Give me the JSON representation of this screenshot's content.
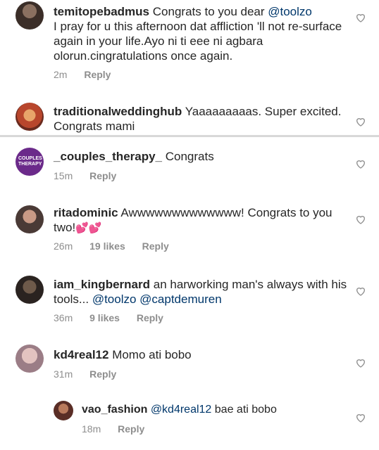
{
  "comments": [
    {
      "username": "temitopebadmus",
      "text_a": "Congrats to you dear ",
      "mention_a": "@toolzo",
      "text_b": "I pray for u this afternoon dat affliction 'll not re-surface again in your life.Ayo ni ti eee ni agbara olorun.cingratulations once again.",
      "time": "2m",
      "reply": "Reply"
    },
    {
      "username": "traditionalweddinghub",
      "text_a": "Yaaaaaaaaas.  Super excited. Congrats mami"
    },
    {
      "username": "_couples_therapy_",
      "text_a": "Congrats",
      "time": "15m",
      "reply": "Reply",
      "avatar_text": "COUPLES THERAPY"
    },
    {
      "username": "ritadominic",
      "text_a": "Awwwwwwwwwwwww! Congrats to you two!",
      "emoji": "💕💕",
      "time": "26m",
      "likes": "19 likes",
      "reply": "Reply"
    },
    {
      "username": "iam_kingbernard",
      "text_a": "an harworking man's always with his tools... ",
      "mention_a": "@toolzo",
      "mention_b": "@captdemuren",
      "time": "36m",
      "likes": "9 likes",
      "reply": "Reply"
    },
    {
      "username": "kd4real12",
      "text_a": "Momo ati bobo",
      "time": "31m",
      "reply": "Reply"
    },
    {
      "username": "vao_fashion",
      "mention_a": "@kd4real12",
      "text_a": " bae ati bobo",
      "time": "18m",
      "reply": "Reply"
    }
  ],
  "icons": {
    "like": "heart-outline-icon"
  },
  "colors": {
    "mention": "#00376b",
    "meta": "#8e8e8e",
    "emoji": "#e0457b"
  }
}
